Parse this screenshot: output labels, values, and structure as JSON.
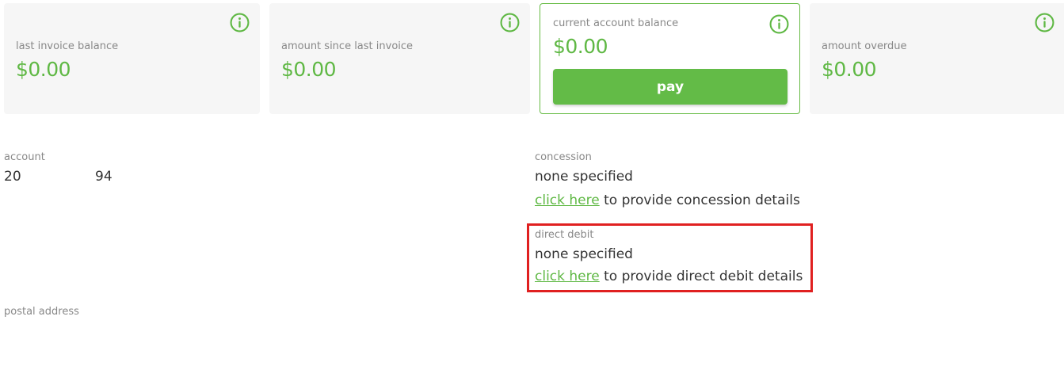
{
  "summary_cards": [
    {
      "label": "last invoice balance",
      "value": "$0.00",
      "icon": "info-icon"
    },
    {
      "label": "amount since last invoice",
      "value": "$0.00",
      "icon": "info-icon"
    },
    {
      "label": "current account balance",
      "value": "$0.00",
      "icon": "info-icon",
      "button_label": "pay"
    },
    {
      "label": "amount overdue",
      "value": "$0.00",
      "icon": "info-icon"
    }
  ],
  "account": {
    "label": "account",
    "number_part1": "20",
    "number_part2": "94"
  },
  "concession": {
    "label": "concession",
    "value": "none specified",
    "link_text": "click here",
    "link_suffix": " to provide concession details"
  },
  "direct_debit": {
    "label": "direct debit",
    "value": "none specified",
    "link_text": "click here",
    "link_suffix": " to provide direct debit details"
  },
  "postal_address": {
    "label": "postal address"
  },
  "colors": {
    "accent_green": "#5fb844",
    "card_background": "#f6f6f6",
    "highlight_red": "#e02020"
  }
}
